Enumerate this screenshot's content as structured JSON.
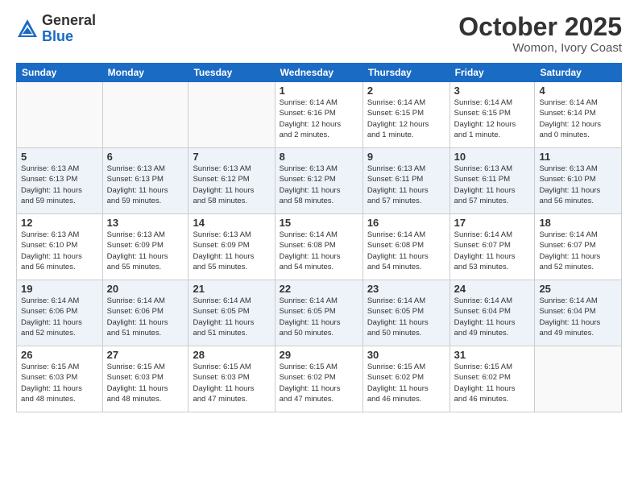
{
  "logo": {
    "general": "General",
    "blue": "Blue"
  },
  "header": {
    "month": "October 2025",
    "location": "Womon, Ivory Coast"
  },
  "weekdays": [
    "Sunday",
    "Monday",
    "Tuesday",
    "Wednesday",
    "Thursday",
    "Friday",
    "Saturday"
  ],
  "weeks": [
    [
      {
        "day": "",
        "info": ""
      },
      {
        "day": "",
        "info": ""
      },
      {
        "day": "",
        "info": ""
      },
      {
        "day": "1",
        "info": "Sunrise: 6:14 AM\nSunset: 6:16 PM\nDaylight: 12 hours\nand 2 minutes."
      },
      {
        "day": "2",
        "info": "Sunrise: 6:14 AM\nSunset: 6:15 PM\nDaylight: 12 hours\nand 1 minute."
      },
      {
        "day": "3",
        "info": "Sunrise: 6:14 AM\nSunset: 6:15 PM\nDaylight: 12 hours\nand 1 minute."
      },
      {
        "day": "4",
        "info": "Sunrise: 6:14 AM\nSunset: 6:14 PM\nDaylight: 12 hours\nand 0 minutes."
      }
    ],
    [
      {
        "day": "5",
        "info": "Sunrise: 6:13 AM\nSunset: 6:13 PM\nDaylight: 11 hours\nand 59 minutes."
      },
      {
        "day": "6",
        "info": "Sunrise: 6:13 AM\nSunset: 6:13 PM\nDaylight: 11 hours\nand 59 minutes."
      },
      {
        "day": "7",
        "info": "Sunrise: 6:13 AM\nSunset: 6:12 PM\nDaylight: 11 hours\nand 58 minutes."
      },
      {
        "day": "8",
        "info": "Sunrise: 6:13 AM\nSunset: 6:12 PM\nDaylight: 11 hours\nand 58 minutes."
      },
      {
        "day": "9",
        "info": "Sunrise: 6:13 AM\nSunset: 6:11 PM\nDaylight: 11 hours\nand 57 minutes."
      },
      {
        "day": "10",
        "info": "Sunrise: 6:13 AM\nSunset: 6:11 PM\nDaylight: 11 hours\nand 57 minutes."
      },
      {
        "day": "11",
        "info": "Sunrise: 6:13 AM\nSunset: 6:10 PM\nDaylight: 11 hours\nand 56 minutes."
      }
    ],
    [
      {
        "day": "12",
        "info": "Sunrise: 6:13 AM\nSunset: 6:10 PM\nDaylight: 11 hours\nand 56 minutes."
      },
      {
        "day": "13",
        "info": "Sunrise: 6:13 AM\nSunset: 6:09 PM\nDaylight: 11 hours\nand 55 minutes."
      },
      {
        "day": "14",
        "info": "Sunrise: 6:13 AM\nSunset: 6:09 PM\nDaylight: 11 hours\nand 55 minutes."
      },
      {
        "day": "15",
        "info": "Sunrise: 6:14 AM\nSunset: 6:08 PM\nDaylight: 11 hours\nand 54 minutes."
      },
      {
        "day": "16",
        "info": "Sunrise: 6:14 AM\nSunset: 6:08 PM\nDaylight: 11 hours\nand 54 minutes."
      },
      {
        "day": "17",
        "info": "Sunrise: 6:14 AM\nSunset: 6:07 PM\nDaylight: 11 hours\nand 53 minutes."
      },
      {
        "day": "18",
        "info": "Sunrise: 6:14 AM\nSunset: 6:07 PM\nDaylight: 11 hours\nand 52 minutes."
      }
    ],
    [
      {
        "day": "19",
        "info": "Sunrise: 6:14 AM\nSunset: 6:06 PM\nDaylight: 11 hours\nand 52 minutes."
      },
      {
        "day": "20",
        "info": "Sunrise: 6:14 AM\nSunset: 6:06 PM\nDaylight: 11 hours\nand 51 minutes."
      },
      {
        "day": "21",
        "info": "Sunrise: 6:14 AM\nSunset: 6:05 PM\nDaylight: 11 hours\nand 51 minutes."
      },
      {
        "day": "22",
        "info": "Sunrise: 6:14 AM\nSunset: 6:05 PM\nDaylight: 11 hours\nand 50 minutes."
      },
      {
        "day": "23",
        "info": "Sunrise: 6:14 AM\nSunset: 6:05 PM\nDaylight: 11 hours\nand 50 minutes."
      },
      {
        "day": "24",
        "info": "Sunrise: 6:14 AM\nSunset: 6:04 PM\nDaylight: 11 hours\nand 49 minutes."
      },
      {
        "day": "25",
        "info": "Sunrise: 6:14 AM\nSunset: 6:04 PM\nDaylight: 11 hours\nand 49 minutes."
      }
    ],
    [
      {
        "day": "26",
        "info": "Sunrise: 6:15 AM\nSunset: 6:03 PM\nDaylight: 11 hours\nand 48 minutes."
      },
      {
        "day": "27",
        "info": "Sunrise: 6:15 AM\nSunset: 6:03 PM\nDaylight: 11 hours\nand 48 minutes."
      },
      {
        "day": "28",
        "info": "Sunrise: 6:15 AM\nSunset: 6:03 PM\nDaylight: 11 hours\nand 47 minutes."
      },
      {
        "day": "29",
        "info": "Sunrise: 6:15 AM\nSunset: 6:02 PM\nDaylight: 11 hours\nand 47 minutes."
      },
      {
        "day": "30",
        "info": "Sunrise: 6:15 AM\nSunset: 6:02 PM\nDaylight: 11 hours\nand 46 minutes."
      },
      {
        "day": "31",
        "info": "Sunrise: 6:15 AM\nSunset: 6:02 PM\nDaylight: 11 hours\nand 46 minutes."
      },
      {
        "day": "",
        "info": ""
      }
    ]
  ]
}
